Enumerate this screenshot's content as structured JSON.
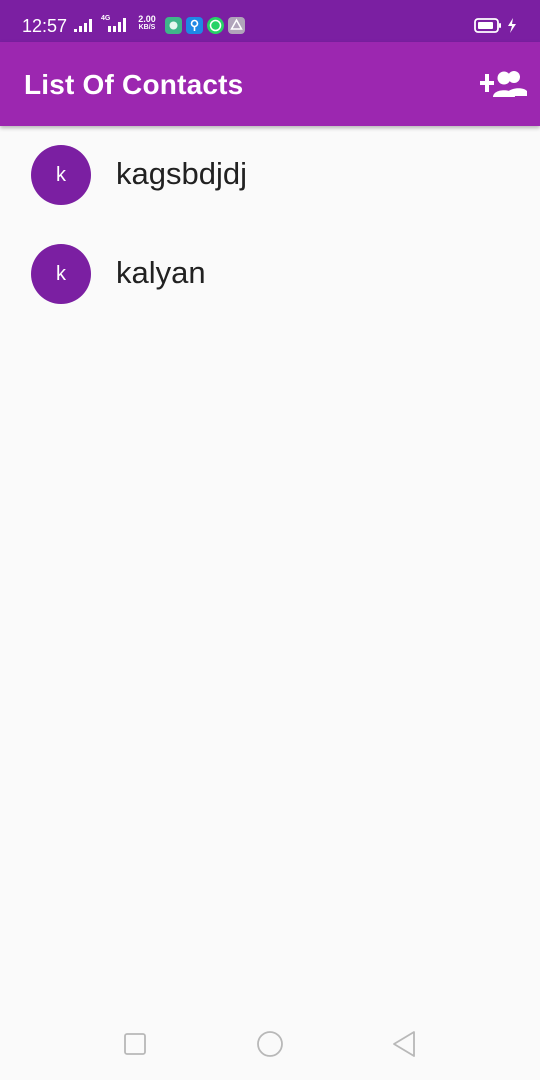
{
  "status_bar": {
    "time": "12:57",
    "network_type": "4G",
    "net_speed_value": "2.00",
    "net_speed_unit": "KB/S",
    "notification_icons": [
      "image-app-icon",
      "vpn-key-icon",
      "whatsapp-icon",
      "drive-icon"
    ],
    "charging": true
  },
  "app_bar": {
    "title": "List Of Contacts",
    "action_icon": "add-group-icon",
    "color": "#9c27b0"
  },
  "contacts": [
    {
      "initial": "k",
      "name": "kagsbdjdj"
    },
    {
      "initial": "k",
      "name": "kalyan"
    }
  ],
  "colors": {
    "status_bar": "#7b1fa2",
    "avatar": "#7b1fa2",
    "background": "#fafafa"
  },
  "nav_bar": {
    "buttons": [
      "recent-apps-button",
      "home-button",
      "back-button"
    ]
  }
}
